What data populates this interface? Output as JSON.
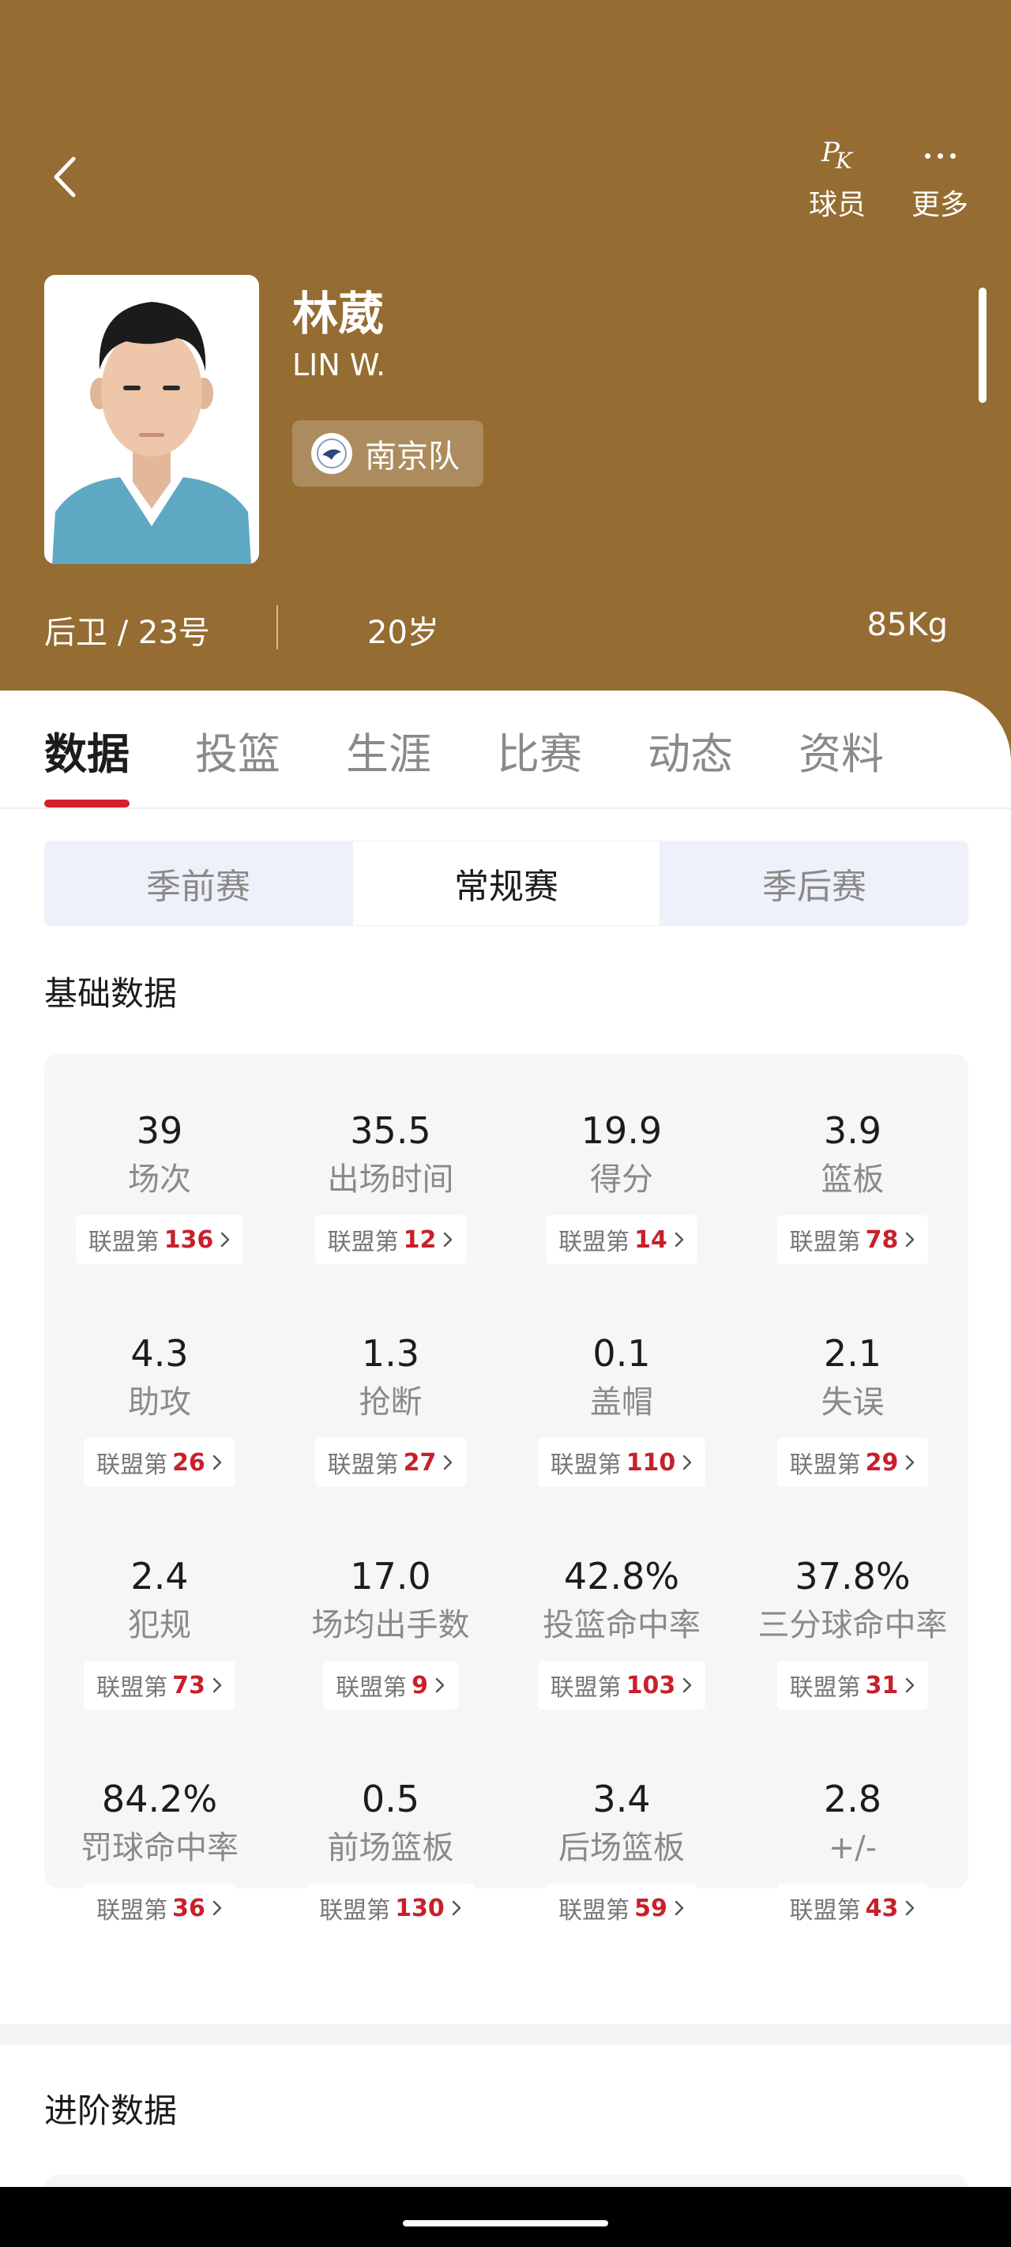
{
  "header": {
    "actions": [
      {
        "label": "球员",
        "icon": "pk-icon"
      },
      {
        "label": "更多",
        "icon": "more-dots-icon"
      }
    ],
    "player": {
      "name": "林葳",
      "name_en": "LIN W.",
      "team": "南京队",
      "position": "后卫 / 23号",
      "age": "20岁",
      "weight": "85Kg"
    },
    "colors": {
      "header_bg": "#956C31",
      "accent": "#D7202B"
    }
  },
  "tabs": [
    "数据",
    "投篮",
    "生涯",
    "比赛",
    "动态",
    "资料"
  ],
  "active_tab": "数据",
  "segments": [
    "季前赛",
    "常规赛",
    "季后赛"
  ],
  "active_segment": "常规赛",
  "basic": {
    "title": "基础数据",
    "rank_prefix": "联盟第",
    "stats": [
      {
        "value": "39",
        "label": "场次",
        "rank": "136"
      },
      {
        "value": "35.5",
        "label": "出场时间",
        "rank": "12"
      },
      {
        "value": "19.9",
        "label": "得分",
        "rank": "14"
      },
      {
        "value": "3.9",
        "label": "篮板",
        "rank": "78"
      },
      {
        "value": "4.3",
        "label": "助攻",
        "rank": "26"
      },
      {
        "value": "1.3",
        "label": "抢断",
        "rank": "27"
      },
      {
        "value": "0.1",
        "label": "盖帽",
        "rank": "110"
      },
      {
        "value": "2.1",
        "label": "失误",
        "rank": "29"
      },
      {
        "value": "2.4",
        "label": "犯规",
        "rank": "73"
      },
      {
        "value": "17.0",
        "label": "场均出手数",
        "rank": "9"
      },
      {
        "value": "42.8%",
        "label": "投篮命中率",
        "rank": "103"
      },
      {
        "value": "37.8%",
        "label": "三分球命中率",
        "rank": "31"
      },
      {
        "value": "84.2%",
        "label": "罚球命中率",
        "rank": "36"
      },
      {
        "value": "0.5",
        "label": "前场篮板",
        "rank": "130"
      },
      {
        "value": "3.4",
        "label": "后场篮板",
        "rank": "59"
      },
      {
        "value": "2.8",
        "label": "+/-",
        "rank": "43"
      }
    ]
  },
  "advanced": {
    "title": "进阶数据"
  }
}
